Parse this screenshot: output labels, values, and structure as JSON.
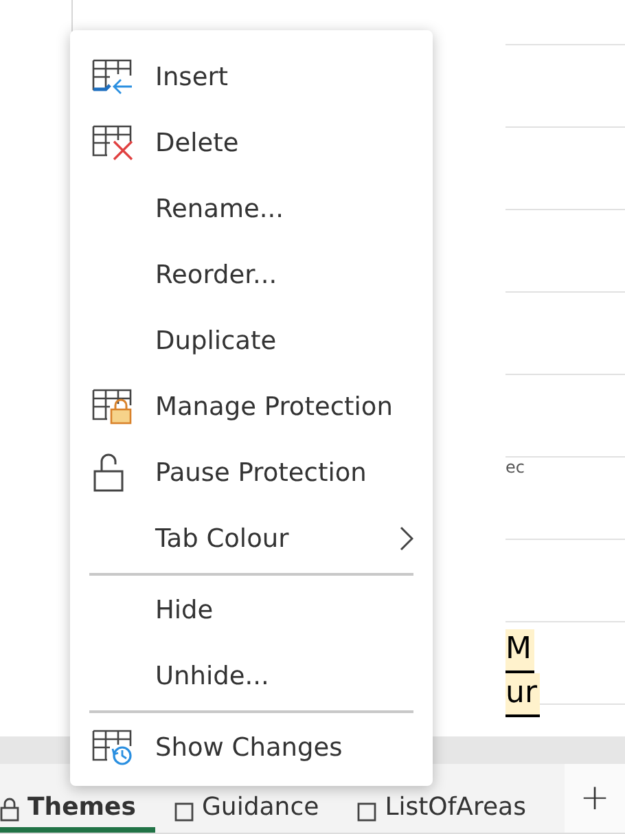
{
  "sheet": {
    "cell_fragments": [
      {
        "text": "ec",
        "kind": "plain"
      },
      {
        "text": "M",
        "kind": "header"
      },
      {
        "text": "ur",
        "kind": "header"
      }
    ]
  },
  "sheet_tabs": [
    {
      "label": "Themes",
      "kind": "lock",
      "selected": true
    },
    {
      "label": "Guidance",
      "kind": "sheet",
      "selected": false
    },
    {
      "label": "ListOfAreas",
      "kind": "sheet",
      "selected": false
    }
  ],
  "add_sheet": "+",
  "context_menu": [
    {
      "label": "Insert",
      "kind": "insert"
    },
    {
      "label": "Delete",
      "kind": "delete"
    },
    {
      "label": "Rename...",
      "kind": "plain"
    },
    {
      "label": "Reorder...",
      "kind": "plain"
    },
    {
      "label": "Duplicate",
      "kind": "plain"
    },
    {
      "label": "Manage Protection",
      "kind": "protect"
    },
    {
      "label": "Pause Protection",
      "kind": "unlock"
    },
    {
      "label": "Tab Colour",
      "kind": "submenu"
    },
    {
      "kind": "separator"
    },
    {
      "label": "Hide",
      "kind": "plain"
    },
    {
      "label": "Unhide...",
      "kind": "plain"
    },
    {
      "kind": "separator"
    },
    {
      "label": "Show Changes",
      "kind": "history"
    }
  ]
}
